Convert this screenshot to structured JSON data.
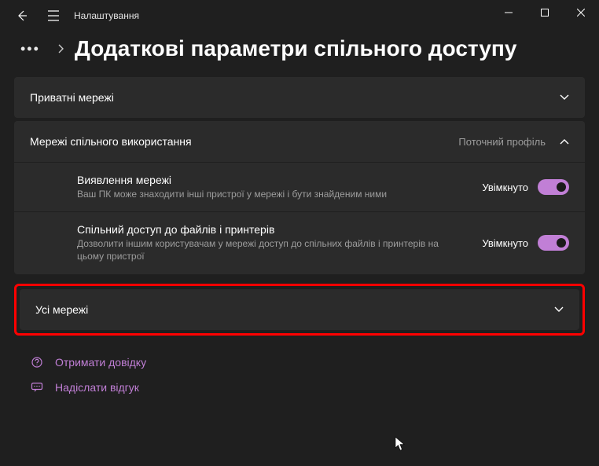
{
  "app": {
    "title": "Налаштування"
  },
  "breadcrumb": {
    "title": "Додаткові параметри спільного доступу"
  },
  "panels": {
    "private": {
      "title": "Приватні мережі"
    },
    "shared": {
      "title": "Мережі спільного використання",
      "badge": "Поточний профіль",
      "settings": {
        "discovery": {
          "title": "Виявлення мережі",
          "desc": "Ваш ПК може знаходити інші пристрої у мережі і бути знайденим ними",
          "state": "Увімкнуто"
        },
        "sharing": {
          "title": "Спільний доступ до файлів і принтерів",
          "desc": "Дозволити іншим користувачам у мережі доступ до спільних файлів і принтерів на цьому пристрої",
          "state": "Увімкнуто"
        }
      }
    },
    "all": {
      "title": "Усі мережі"
    }
  },
  "footer": {
    "help": "Отримати довідку",
    "feedback": "Надіслати відгук"
  }
}
